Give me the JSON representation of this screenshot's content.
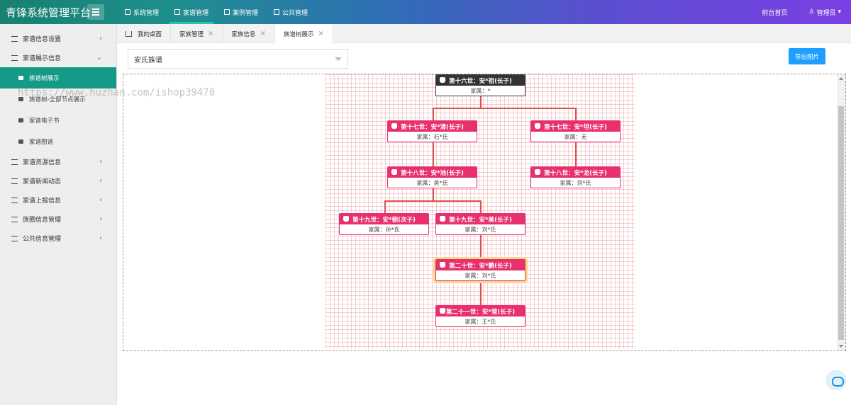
{
  "app": {
    "title": "青锋系统管理平台"
  },
  "topnav": [
    {
      "label": "系统管理",
      "icon": "grid-icon",
      "active": false
    },
    {
      "label": "家谱管理",
      "icon": "layers-icon",
      "active": true
    },
    {
      "label": "案例管理",
      "icon": "table-icon",
      "active": false
    },
    {
      "label": "公共管理",
      "icon": "grid-icon",
      "active": false
    }
  ],
  "header_right": {
    "frontpage": "前台首页",
    "user": "管理员"
  },
  "sidebar": {
    "items": [
      {
        "label": "家谱信息设置"
      },
      {
        "label": "家谱展示信息"
      },
      {
        "label": "族谱树展示"
      },
      {
        "label": "族谱树-全部节点展示"
      },
      {
        "label": "家谱电子书"
      },
      {
        "label": "家谱图谱"
      },
      {
        "label": "家谱资源信息"
      },
      {
        "label": "家谱新闻动态"
      },
      {
        "label": "家谱上报信息"
      },
      {
        "label": "族圈信息管理"
      },
      {
        "label": "公共信息管理"
      }
    ]
  },
  "tabs": [
    {
      "label": "我的桌面"
    },
    {
      "label": "家族管理"
    },
    {
      "label": "家族信息"
    },
    {
      "label": "族谱树展示"
    }
  ],
  "selector": {
    "value": "安氏族谱"
  },
  "export_label": "导出图片",
  "watermark": "https://www.huzhan.com/ishop39470",
  "tree": {
    "spouse_prefix": "家属：",
    "nodes": [
      {
        "title": "第十六世：安*祖(长子)",
        "spouse": "*"
      },
      {
        "title": "第十七世：安*清(长子)",
        "spouse": "石*氏"
      },
      {
        "title": "第十七世：安*坦(长子)",
        "spouse": "无"
      },
      {
        "title": "第十八世：安*池(长子)",
        "spouse": "吴*氏"
      },
      {
        "title": "第十八世：安*龙(长子)",
        "spouse": "刘*氏"
      },
      {
        "title": "第十九世：安*朝(次子)",
        "spouse": "孙*氏"
      },
      {
        "title": "第十九世：安*美(长子)",
        "spouse": "刘*氏"
      },
      {
        "title": "第二十世：安*鹏(长子)",
        "spouse": "刘*氏"
      },
      {
        "title": "第二十一世：安*莹(长子)",
        "spouse": "王*氏"
      }
    ]
  }
}
